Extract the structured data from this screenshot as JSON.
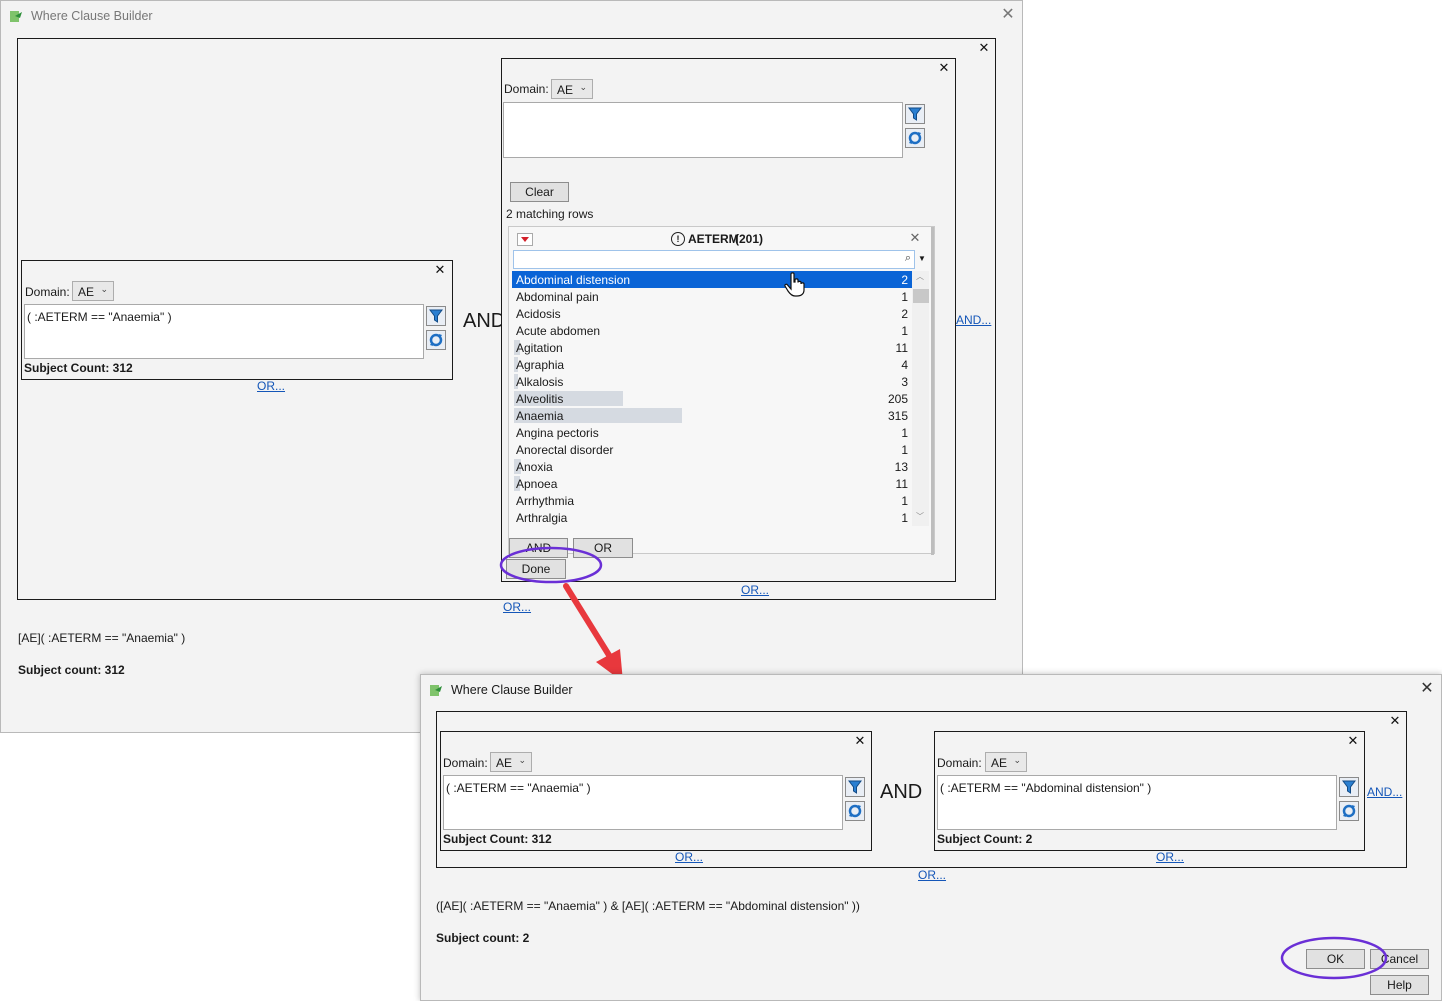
{
  "window1": {
    "title": "Where Clause Builder",
    "left_filter": {
      "domain_label": "Domain:",
      "domain_value": "AE",
      "expression": "( :AETERM == \"Anaemia\" )",
      "subject_count": "Subject Count: 312",
      "or_link": "OR..."
    },
    "operator": "AND",
    "right_filter": {
      "domain_label": "Domain:",
      "domain_value": "AE",
      "expression": "",
      "clear_button": "Clear",
      "matching_rows": "2 matching rows",
      "list_header": "AETERM",
      "list_header_count": "(201)",
      "search_value": "",
      "items": [
        {
          "name": "Abdominal distension",
          "count": "2",
          "selected": true,
          "fraction": 0.0
        },
        {
          "name": "Abdominal pain",
          "count": "1",
          "selected": false,
          "fraction": 0.0
        },
        {
          "name": "Acidosis",
          "count": "2",
          "selected": false,
          "fraction": 0.0
        },
        {
          "name": "Acute abdomen",
          "count": "1",
          "selected": false,
          "fraction": 0.0
        },
        {
          "name": "Agitation",
          "count": "11",
          "selected": false,
          "fraction": 0.035
        },
        {
          "name": "Agraphia",
          "count": "4",
          "selected": false,
          "fraction": 0.013
        },
        {
          "name": "Alkalosis",
          "count": "3",
          "selected": false,
          "fraction": 0.01
        },
        {
          "name": "Alveolitis",
          "count": "205",
          "selected": false,
          "fraction": 0.65
        },
        {
          "name": "Anaemia",
          "count": "315",
          "selected": false,
          "fraction": 1.0
        },
        {
          "name": "Angina pectoris",
          "count": "1",
          "selected": false,
          "fraction": 0.0
        },
        {
          "name": "Anorectal disorder",
          "count": "1",
          "selected": false,
          "fraction": 0.0
        },
        {
          "name": "Anoxia",
          "count": "13",
          "selected": false,
          "fraction": 0.04
        },
        {
          "name": "Apnoea",
          "count": "11",
          "selected": false,
          "fraction": 0.035
        },
        {
          "name": "Arrhythmia",
          "count": "1",
          "selected": false,
          "fraction": 0.0
        },
        {
          "name": "Arthralgia",
          "count": "1",
          "selected": false,
          "fraction": 0.0
        }
      ],
      "and_button": "AND",
      "or_button": "OR",
      "done_button": "Done",
      "and_link": "AND...",
      "or_link": "OR..."
    },
    "outer_or_link": "OR...",
    "where_clause": "[AE]( :AETERM == \"Anaemia\" )",
    "subject_count": "Subject count: 312"
  },
  "window2": {
    "title": "Where Clause Builder",
    "left_filter": {
      "domain_label": "Domain:",
      "domain_value": "AE",
      "expression": "( :AETERM == \"Anaemia\" )",
      "subject_count": "Subject Count: 312",
      "or_link": "OR..."
    },
    "operator": "AND",
    "right_filter": {
      "domain_label": "Domain:",
      "domain_value": "AE",
      "expression": "( :AETERM == \"Abdominal distension\" )",
      "subject_count": "Subject Count: 2",
      "or_link": "OR..."
    },
    "and_link": "AND...",
    "outer_or_link": "OR...",
    "where_clause": "([AE]( :AETERM == \"Anaemia\" ) & [AE]( :AETERM == \"Abdominal distension\" ))",
    "subject_count": "Subject count: 2",
    "ok_button": "OK",
    "cancel_button": "Cancel",
    "help_button": "Help"
  },
  "colors": {
    "selection": "#0a64d6",
    "highlight_circle": "#6a2fd6",
    "arrow": "#e8383d",
    "link": "#1456b8"
  }
}
